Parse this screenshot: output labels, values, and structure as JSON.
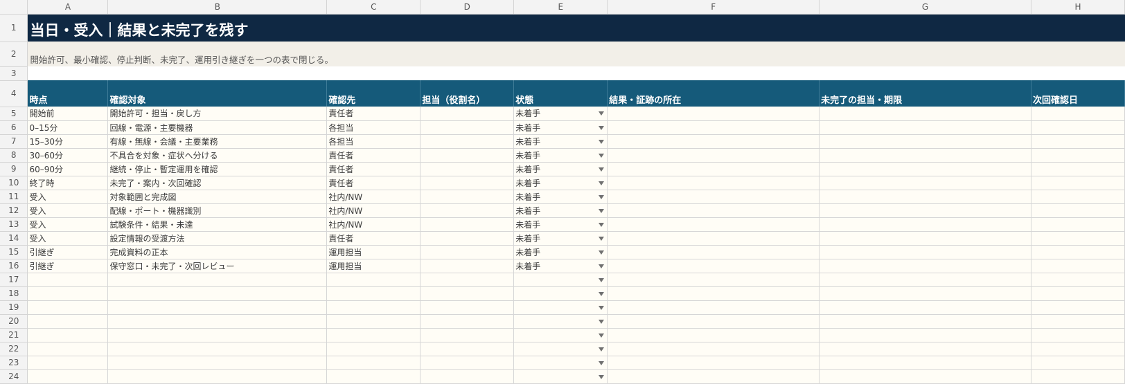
{
  "columns": [
    "A",
    "B",
    "C",
    "D",
    "E",
    "F",
    "G",
    "H"
  ],
  "rows": {
    "r1": "1",
    "r2": "2",
    "r3": "3",
    "r4": "4",
    "r5": "5",
    "r6": "6",
    "r7": "7",
    "r8": "8",
    "r9": "9",
    "r10": "10",
    "r11": "11",
    "r12": "12",
    "r13": "13",
    "r14": "14",
    "r15": "15",
    "r16": "16",
    "r17": "17",
    "r18": "18",
    "r19": "19",
    "r20": "20",
    "r21": "21",
    "r22": "22",
    "r23": "23",
    "r24": "24"
  },
  "sheet": {
    "title": "当日・受入｜結果と未完了を残す",
    "subtitle": "開始許可、最小確認、停止判断、未完了、運用引き継ぎを一つの表で閉じる。"
  },
  "headers": [
    "時点",
    "確認対象",
    "確認先",
    "担当（役割名）",
    "状態",
    "結果・証跡の所在",
    "未完了の担当・期限",
    "次回確認日"
  ],
  "data": [
    {
      "a": "開始前",
      "b": "開始許可・担当・戻し方",
      "c": "責任者",
      "d": "",
      "e": "未着手",
      "f": "",
      "g": "",
      "h": ""
    },
    {
      "a": "0–15分",
      "b": "回線・電源・主要機器",
      "c": "各担当",
      "d": "",
      "e": "未着手",
      "f": "",
      "g": "",
      "h": ""
    },
    {
      "a": "15–30分",
      "b": "有線・無線・会議・主要業務",
      "c": "各担当",
      "d": "",
      "e": "未着手",
      "f": "",
      "g": "",
      "h": ""
    },
    {
      "a": "30–60分",
      "b": "不具合を対象・症状へ分ける",
      "c": "責任者",
      "d": "",
      "e": "未着手",
      "f": "",
      "g": "",
      "h": ""
    },
    {
      "a": "60–90分",
      "b": "継続・停止・暫定運用を確認",
      "c": "責任者",
      "d": "",
      "e": "未着手",
      "f": "",
      "g": "",
      "h": ""
    },
    {
      "a": "終了時",
      "b": "未完了・案内・次回確認",
      "c": "責任者",
      "d": "",
      "e": "未着手",
      "f": "",
      "g": "",
      "h": ""
    },
    {
      "a": "受入",
      "b": "対象範囲と完成図",
      "c": "社内/NW",
      "d": "",
      "e": "未着手",
      "f": "",
      "g": "",
      "h": ""
    },
    {
      "a": "受入",
      "b": "配線・ポート・機器識別",
      "c": "社内/NW",
      "d": "",
      "e": "未着手",
      "f": "",
      "g": "",
      "h": ""
    },
    {
      "a": "受入",
      "b": "試験条件・結果・未達",
      "c": "社内/NW",
      "d": "",
      "e": "未着手",
      "f": "",
      "g": "",
      "h": ""
    },
    {
      "a": "受入",
      "b": "設定情報の受渡方法",
      "c": "責任者",
      "d": "",
      "e": "未着手",
      "f": "",
      "g": "",
      "h": ""
    },
    {
      "a": "引継ぎ",
      "b": "完成資料の正本",
      "c": "運用担当",
      "d": "",
      "e": "未着手",
      "f": "",
      "g": "",
      "h": ""
    },
    {
      "a": "引継ぎ",
      "b": "保守窓口・未完了・次回レビュー",
      "c": "運用担当",
      "d": "",
      "e": "未着手",
      "f": "",
      "g": "",
      "h": ""
    },
    {
      "a": "",
      "b": "",
      "c": "",
      "d": "",
      "e": "",
      "f": "",
      "g": "",
      "h": ""
    },
    {
      "a": "",
      "b": "",
      "c": "",
      "d": "",
      "e": "",
      "f": "",
      "g": "",
      "h": ""
    },
    {
      "a": "",
      "b": "",
      "c": "",
      "d": "",
      "e": "",
      "f": "",
      "g": "",
      "h": ""
    },
    {
      "a": "",
      "b": "",
      "c": "",
      "d": "",
      "e": "",
      "f": "",
      "g": "",
      "h": ""
    },
    {
      "a": "",
      "b": "",
      "c": "",
      "d": "",
      "e": "",
      "f": "",
      "g": "",
      "h": ""
    },
    {
      "a": "",
      "b": "",
      "c": "",
      "d": "",
      "e": "",
      "f": "",
      "g": "",
      "h": ""
    },
    {
      "a": "",
      "b": "",
      "c": "",
      "d": "",
      "e": "",
      "f": "",
      "g": "",
      "h": ""
    },
    {
      "a": "",
      "b": "",
      "c": "",
      "d": "",
      "e": "",
      "f": "",
      "g": "",
      "h": ""
    }
  ],
  "colors": {
    "title_bg": "#0f2843",
    "header_bg": "#155a7a",
    "subtitle_bg": "#f2efe8",
    "row_bg": "#fffdf6"
  },
  "icons": {
    "status_dropdown": "chevron-down-icon"
  }
}
